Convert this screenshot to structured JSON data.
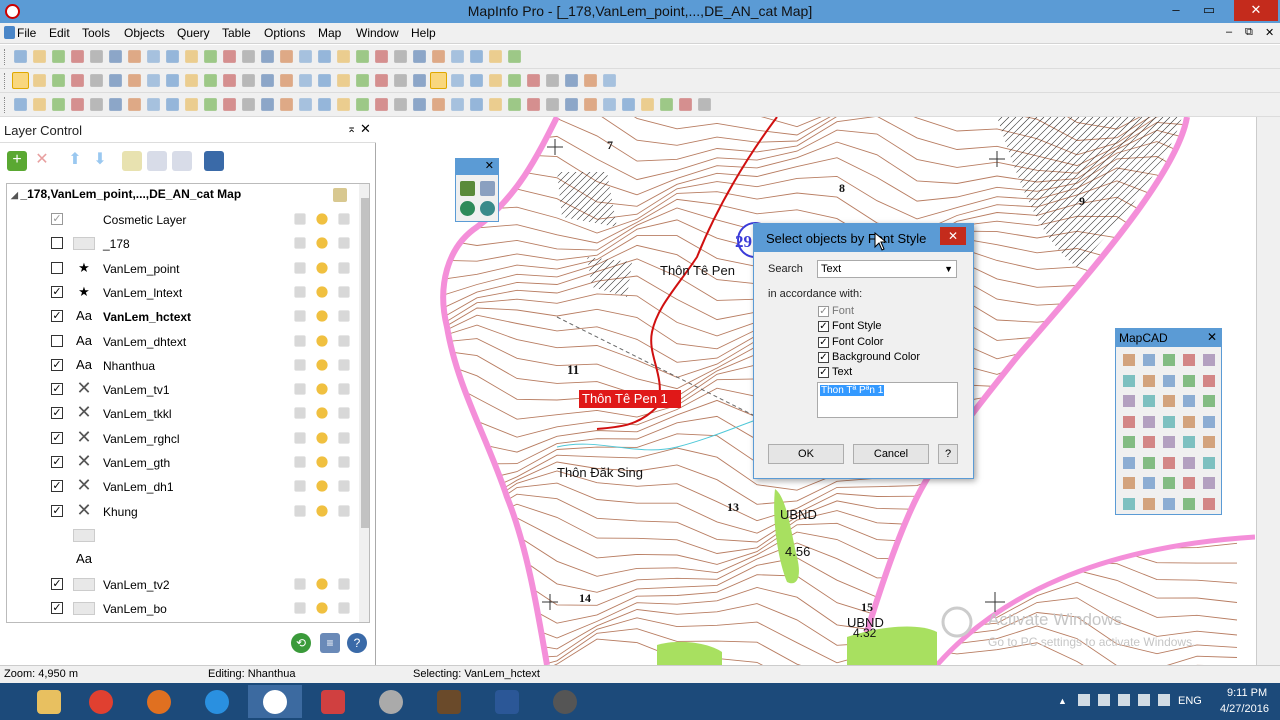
{
  "window": {
    "title": "MapInfo Pro - [_178,VanLem_point,...,DE_AN_cat Map]",
    "min": "–",
    "max": "▭",
    "close": "✕",
    "mdi_min": "–",
    "mdi_restore": "⧉",
    "mdi_close": "✕"
  },
  "menu": [
    "File",
    "Edit",
    "Tools",
    "Objects",
    "Query",
    "Table",
    "Options",
    "Map",
    "Window",
    "Help"
  ],
  "layer_control": {
    "title": "Layer Control",
    "pin": "⌅",
    "close": "✕",
    "map_node": "_178,VanLem_point,...,DE_AN_cat Map",
    "layers": [
      {
        "name": "Cosmetic Layer",
        "checked": true,
        "disabled": true,
        "icon": "none-icon",
        "bold": false
      },
      {
        "name": "_178",
        "checked": false,
        "icon": "region-icon",
        "bold": false
      },
      {
        "name": "VanLem_point",
        "checked": false,
        "icon": "star-icon",
        "bold": false
      },
      {
        "name": "VanLem_lntext",
        "checked": true,
        "icon": "star-icon",
        "bold": false
      },
      {
        "name": "VanLem_hctext",
        "checked": true,
        "icon": "text-icon",
        "bold": true
      },
      {
        "name": "VanLem_dhtext",
        "checked": false,
        "icon": "text-icon",
        "bold": false
      },
      {
        "name": "Nhanthua",
        "checked": true,
        "icon": "text-icon",
        "bold": false
      },
      {
        "name": "VanLem_tv1",
        "checked": true,
        "icon": "line-icon",
        "bold": false
      },
      {
        "name": "VanLem_tkkl",
        "checked": true,
        "icon": "line-icon",
        "bold": false
      },
      {
        "name": "VanLem_rghcl",
        "checked": true,
        "icon": "line-icon",
        "bold": false
      },
      {
        "name": "VanLem_gth",
        "checked": true,
        "icon": "line-icon",
        "bold": false
      },
      {
        "name": "VanLem_dh1",
        "checked": true,
        "icon": "line-icon",
        "bold": false
      },
      {
        "name": "Khung",
        "checked": true,
        "icon": "line-icon",
        "bold": false
      },
      {
        "name": "",
        "checked": null,
        "icon": "region-icon",
        "bold": false
      },
      {
        "name": "",
        "checked": null,
        "icon": "text-icon",
        "bold": false
      },
      {
        "name": "VanLem_tv2",
        "checked": true,
        "icon": "region-icon",
        "bold": false
      },
      {
        "name": "VanLem_bo",
        "checked": true,
        "icon": "region-icon",
        "bold": false
      }
    ],
    "aa_glyph": "Aa",
    "star_glyph": "★",
    "line_glyph": "✕",
    "check_glyph": "✓"
  },
  "map": {
    "labels": [
      {
        "text": "7",
        "bold": true
      },
      {
        "text": "8",
        "bold": true
      },
      {
        "text": "9",
        "bold": true
      },
      {
        "text": "Thôn Tê Pen",
        "bold": false
      },
      {
        "text": "11",
        "bold": true
      },
      {
        "text": "Thôn Tê Pen 1",
        "bold": false,
        "highlight": true
      },
      {
        "text": "Thôn Đăk Sing",
        "bold": false
      },
      {
        "text": "13",
        "bold": true
      },
      {
        "text": "UBND",
        "bold": false
      },
      {
        "text": "4.56",
        "bold": false
      },
      {
        "text": "14",
        "bold": true
      },
      {
        "text": "15",
        "bold": true
      },
      {
        "text": "UBND",
        "bold": false
      },
      {
        "text": "4.32",
        "bold": false
      },
      {
        "text": "29",
        "bold": true
      }
    ],
    "watermark_title": "Activate Windows",
    "watermark_sub": "Go to PC settings to activate Windows."
  },
  "dialog": {
    "title": "Select objects by Font Style",
    "close": "✕",
    "search_label": "Search",
    "search_value": "Text",
    "accordance_label": "in accordance with:",
    "options": [
      {
        "label": "Font",
        "checked": true,
        "disabled": true
      },
      {
        "label": "Font Style",
        "checked": true,
        "disabled": false
      },
      {
        "label": "Font Color",
        "checked": true,
        "disabled": false
      },
      {
        "label": "Background Color",
        "checked": true,
        "disabled": false
      },
      {
        "label": "Text",
        "checked": true,
        "disabled": false
      }
    ],
    "text_value": "Thon Tª Pªn 1",
    "ok": "OK",
    "cancel": "Cancel",
    "help": "?"
  },
  "mapcad": {
    "title": "MapCAD",
    "close": "✕"
  },
  "status": {
    "zoom": "Zoom: 4,950 m",
    "editing": "Editing: Nhanthua",
    "selecting": "Selecting: VanLem_hctext"
  },
  "tray": {
    "lang": "ENG",
    "time": "9:11 PM",
    "date": "4/27/2016",
    "caret": "▲"
  },
  "colors": {
    "titlebar": "#5b9bd5",
    "close_red": "#c42b1c",
    "contour": "#a0522d",
    "boundary_pink": "#f48fd9",
    "red_road": "#d01010",
    "green_area": "#a8e060",
    "highlight": "#e01818",
    "taskbar": "#1c4a7a"
  }
}
